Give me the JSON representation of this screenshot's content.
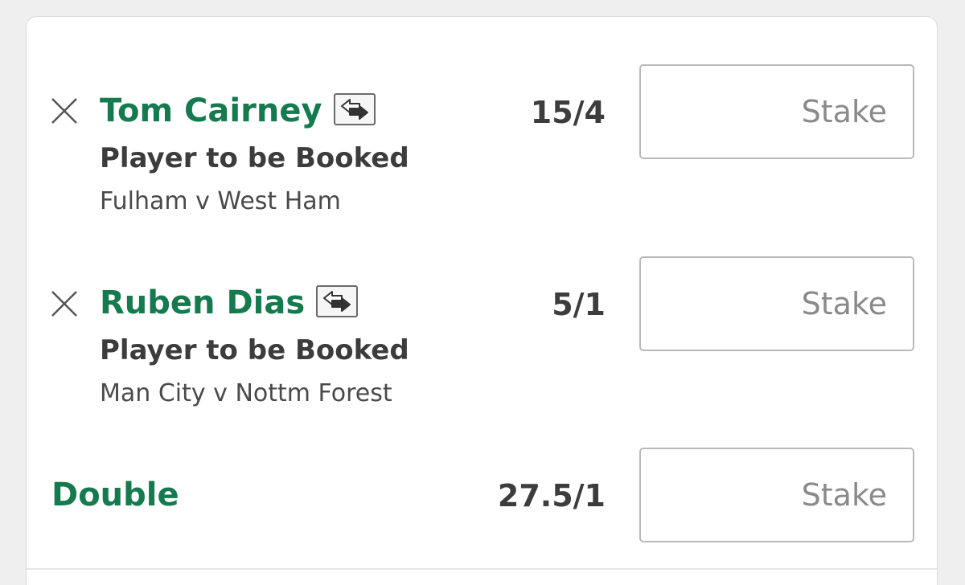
{
  "betslip": {
    "selections": [
      {
        "name": "Tom Cairney",
        "market": "Player to be Booked",
        "event": "Fulham v West Ham",
        "odds": "15/4",
        "stake_placeholder": "Stake",
        "remove_icon": "close-icon",
        "swap_icon": "swap-arrows-icon"
      },
      {
        "name": "Ruben Dias",
        "market": "Player to be Booked",
        "event": "Man City v Nottm Forest",
        "odds": "5/1",
        "stake_placeholder": "Stake",
        "remove_icon": "close-icon",
        "swap_icon": "swap-arrows-icon"
      }
    ],
    "multiple": {
      "label": "Double",
      "odds": "27.5/1",
      "stake_placeholder": "Stake"
    }
  },
  "colors": {
    "accent_green": "#157a4e",
    "text_dark": "#3c3c3c",
    "background": "#efefef"
  }
}
